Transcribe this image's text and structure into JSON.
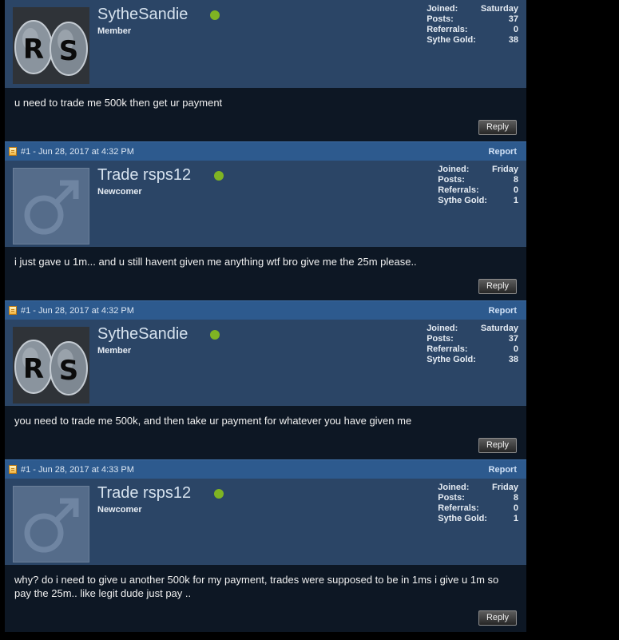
{
  "posts": [
    {
      "header": null,
      "username": "SytheSandie",
      "title": "Member",
      "avatar": "rs",
      "stats": {
        "joined_label": "Joined:",
        "joined": "Saturday",
        "posts_label": "Posts:",
        "posts": "37",
        "referrals_label": "Referrals:",
        "referrals": "0",
        "gold_label": "Sythe Gold:",
        "gold": "38"
      },
      "message": "u need to trade me 500k then get ur payment",
      "reply_label": "Reply"
    },
    {
      "header": {
        "post_num": "#1 - Jun 28, 2017 at 4:32 PM",
        "report_label": "Report"
      },
      "username": "Trade rsps12",
      "title": "Newcomer",
      "avatar": "default",
      "stats": {
        "joined_label": "Joined:",
        "joined": "Friday",
        "posts_label": "Posts:",
        "posts": "8",
        "referrals_label": "Referrals:",
        "referrals": "0",
        "gold_label": "Sythe Gold:",
        "gold": "1"
      },
      "message": "i just gave u 1m... and u still havent given me anything wtf bro give me the 25m please..",
      "reply_label": "Reply"
    },
    {
      "header": {
        "post_num": "#1 - Jun 28, 2017 at 4:32 PM",
        "report_label": "Report"
      },
      "username": "SytheSandie",
      "title": "Member",
      "avatar": "rs",
      "stats": {
        "joined_label": "Joined:",
        "joined": "Saturday",
        "posts_label": "Posts:",
        "posts": "37",
        "referrals_label": "Referrals:",
        "referrals": "0",
        "gold_label": "Sythe Gold:",
        "gold": "38"
      },
      "message": "you need to trade me 500k, and then take ur payment for whatever you have given me",
      "reply_label": "Reply"
    },
    {
      "header": {
        "post_num": "#1 - Jun 28, 2017 at 4:33 PM",
        "report_label": "Report"
      },
      "username": "Trade rsps12",
      "title": "Newcomer",
      "avatar": "default",
      "stats": {
        "joined_label": "Joined:",
        "joined": "Friday",
        "posts_label": "Posts:",
        "posts": "8",
        "referrals_label": "Referrals:",
        "referrals": "0",
        "gold_label": "Sythe Gold:",
        "gold": "1"
      },
      "message": "why? do i need to give u another 500k for my payment, trades were supposed to be in 1ms i give u 1m so pay the 25m.. like legit dude just pay ..",
      "reply_label": "Reply"
    }
  ],
  "colors": {
    "online": "#7fb423",
    "header_bar": "#2d5a8e",
    "userinfo_bg": "#2b4566",
    "content_bg": "#0d1724"
  }
}
